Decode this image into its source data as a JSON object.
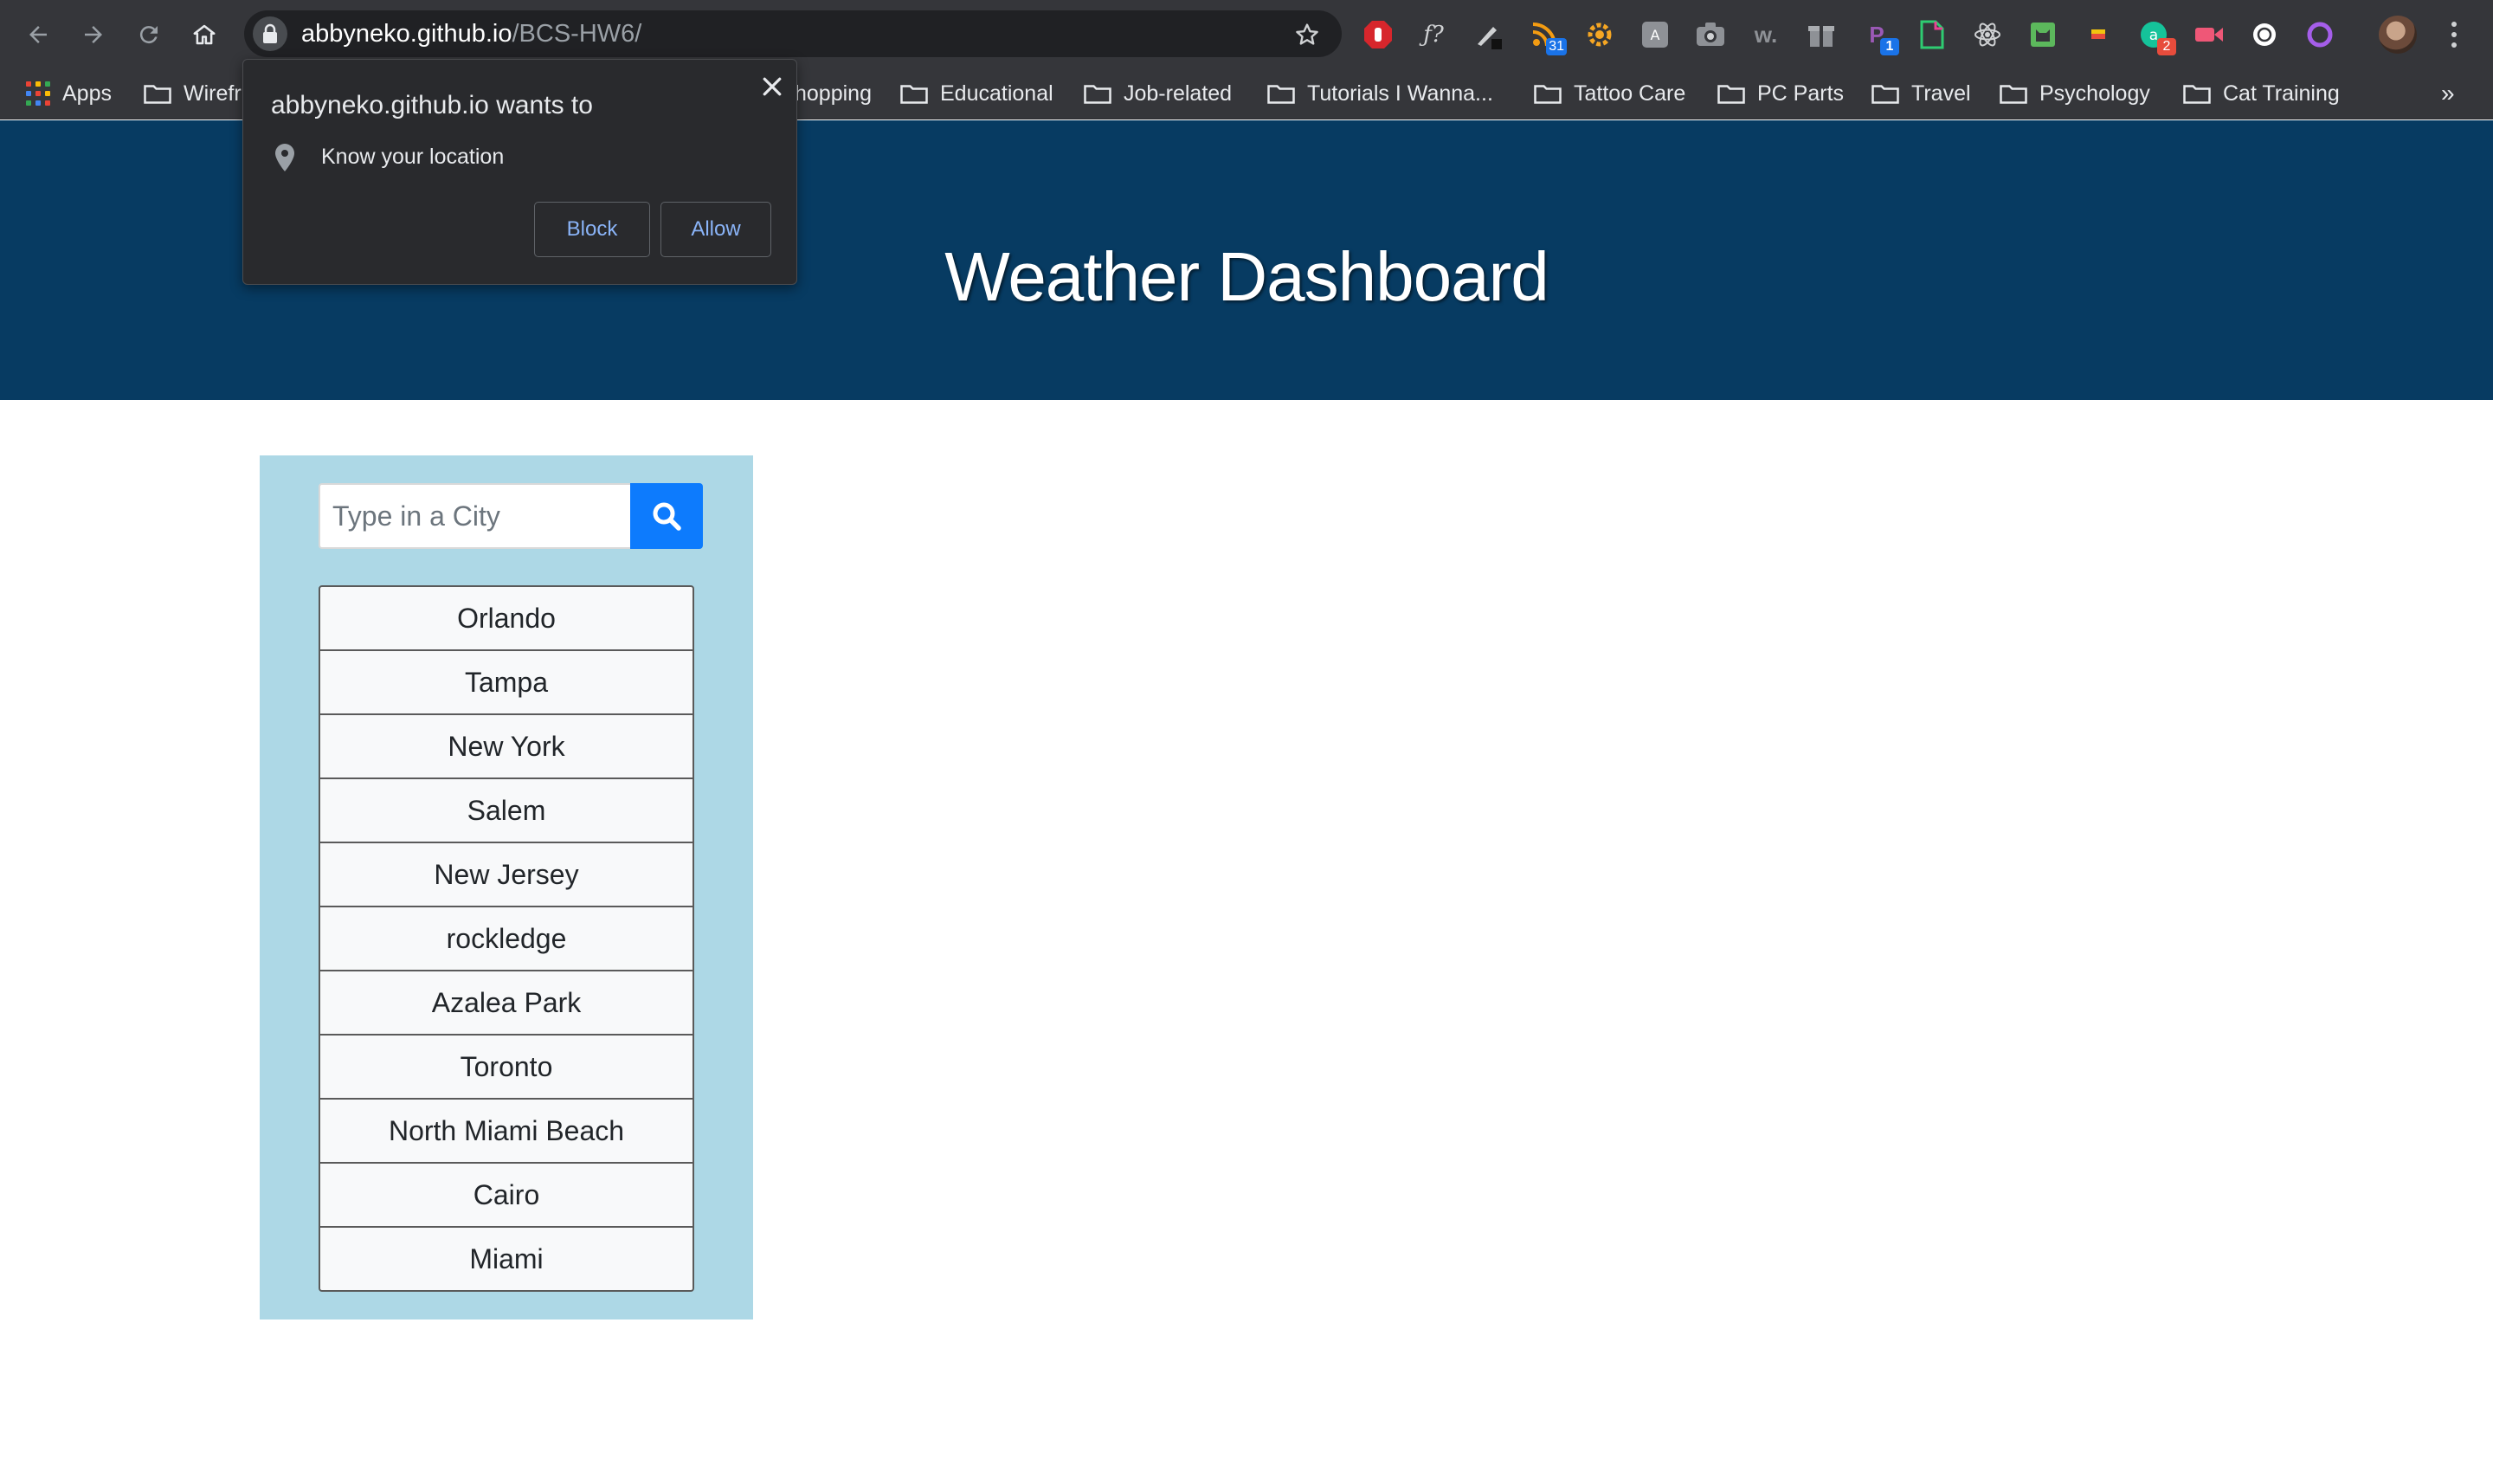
{
  "browser": {
    "url_host": "abbyneko.github.io",
    "url_path": "/BCS-HW6/",
    "extension_badges": {
      "rss": "31",
      "p": "1",
      "grammarly": "2"
    },
    "extension_glyphs": {
      "fx": "ƒ?",
      "wikipedia": "w."
    }
  },
  "bookmarks": {
    "apps_label": "Apps",
    "items": [
      "Wirefr",
      "hopping",
      "Educational",
      "Job-related",
      "Tutorials I Wanna...",
      "Tattoo Care",
      "PC Parts",
      "Travel",
      "Psychology",
      "Cat Training"
    ],
    "overflow": "»"
  },
  "permission_popup": {
    "title": "abbyneko.github.io wants to",
    "permission": "Know your location",
    "block_label": "Block",
    "allow_label": "Allow",
    "close_glyph": "✕"
  },
  "header": {
    "title": "Weather Dashboard"
  },
  "search": {
    "placeholder": "Type in a City",
    "icon": "search-icon"
  },
  "cities": [
    "Orlando",
    "Tampa",
    "New York",
    "Salem",
    "New Jersey",
    "rockledge",
    "Azalea Park",
    "Toronto",
    "North Miami Beach",
    "Cairo",
    "Miami"
  ],
  "colors": {
    "header_bg": "#073b62",
    "panel_bg": "#add8e6",
    "search_button": "#0d7bfd",
    "chrome_bg": "#35363a",
    "link_blue": "#8ab4f8"
  }
}
